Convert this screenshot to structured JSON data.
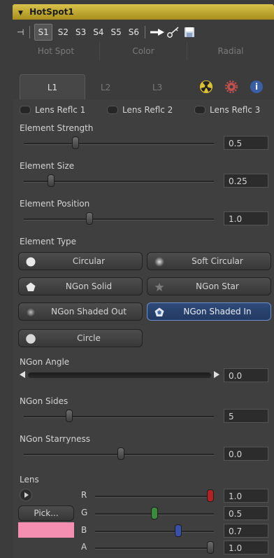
{
  "header": {
    "title": "HotSpot1"
  },
  "toolbar": {
    "scenes": [
      "S1",
      "S2",
      "S3",
      "S4",
      "S5",
      "S6"
    ]
  },
  "tabs_top": [
    "Hot Spot",
    "Color",
    "Radial"
  ],
  "tabs_l": [
    "L1",
    "L2",
    "L3"
  ],
  "lens_reflections": [
    "Lens Reflc 1",
    "Lens Reflc 2",
    "Lens Reflc 3"
  ],
  "element_strength": {
    "label": "Element Strength",
    "value": "0.5"
  },
  "element_size": {
    "label": "Element Size",
    "value": "0.25"
  },
  "element_position": {
    "label": "Element Position",
    "value": "1.0"
  },
  "element_type": {
    "label": "Element Type",
    "options": [
      "Circular",
      "Soft Circular",
      "NGon Solid",
      "NGon Star",
      "NGon Shaded Out",
      "NGon Shaded In",
      "Circle"
    ],
    "selected": "NGon Shaded In"
  },
  "ngon_angle": {
    "label": "NGon Angle",
    "value": "0.0"
  },
  "ngon_sides": {
    "label": "NGon Sides",
    "value": "5"
  },
  "ngon_starryness": {
    "label": "NGon Starryness",
    "value": "0.0"
  },
  "lens": {
    "label": "Lens",
    "pick_label": "Pick...",
    "swatch_color": "#f48fb1",
    "channels": [
      {
        "name": "R",
        "value": "1.0",
        "knob_color": "#b22222"
      },
      {
        "name": "G",
        "value": "0.5",
        "knob_color": "#3c8a3c"
      },
      {
        "name": "B",
        "value": "0.7",
        "knob_color": "#3a4fa8"
      },
      {
        "name": "A",
        "value": "1.0",
        "knob_color": "#5a5a5a"
      }
    ]
  }
}
